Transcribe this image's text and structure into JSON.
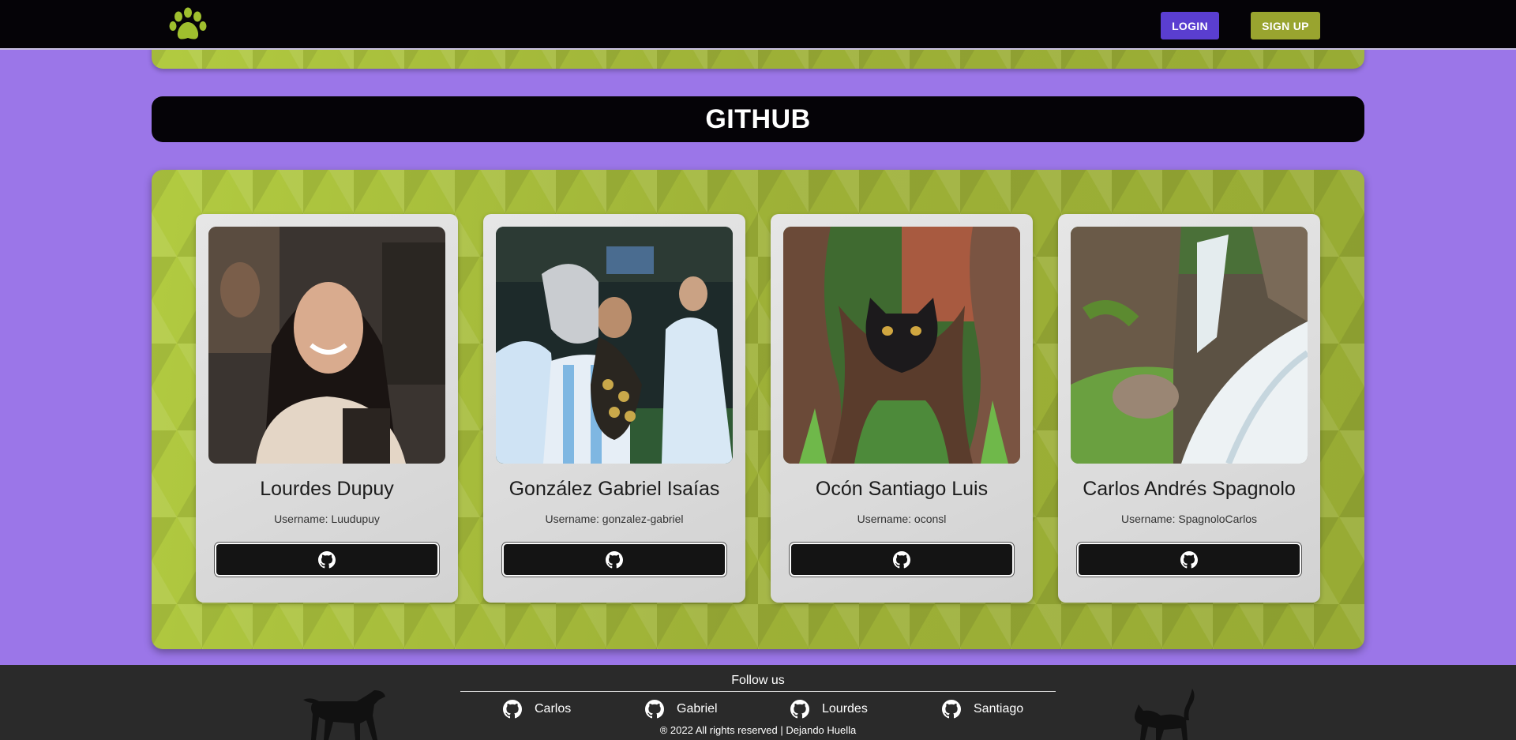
{
  "nav": {
    "login_label": "LOGIN",
    "signup_label": "SIGN UP"
  },
  "section": {
    "title": "GITHUB"
  },
  "members": [
    {
      "name": "Lourdes Dupuy",
      "username": "Username: Luudupuy"
    },
    {
      "name": "González Gabriel Isaías",
      "username": "Username: gonzalez-gabriel"
    },
    {
      "name": "Ocón Santiago Luis",
      "username": "Username: oconsl"
    },
    {
      "name": "Carlos Andrés Spagnolo",
      "username": "Username: SpagnoloCarlos"
    }
  ],
  "footer": {
    "follow_label": "Follow us",
    "links": [
      "Carlos",
      "Gabriel",
      "Lourdes",
      "Santiago"
    ],
    "copyright": "® 2022 All rights reserved | Dejando Huella"
  },
  "colors": {
    "background": "#9b76e8",
    "navbar": "#050307",
    "login_button": "#5a3ed0",
    "signup_button": "#99a42f",
    "panel": "#a3b63a",
    "footer": "#2a2a2a"
  },
  "icons": [
    "paw-logo-icon",
    "github-icon",
    "dog-silhouette-icon",
    "cat-silhouette-icon"
  ]
}
